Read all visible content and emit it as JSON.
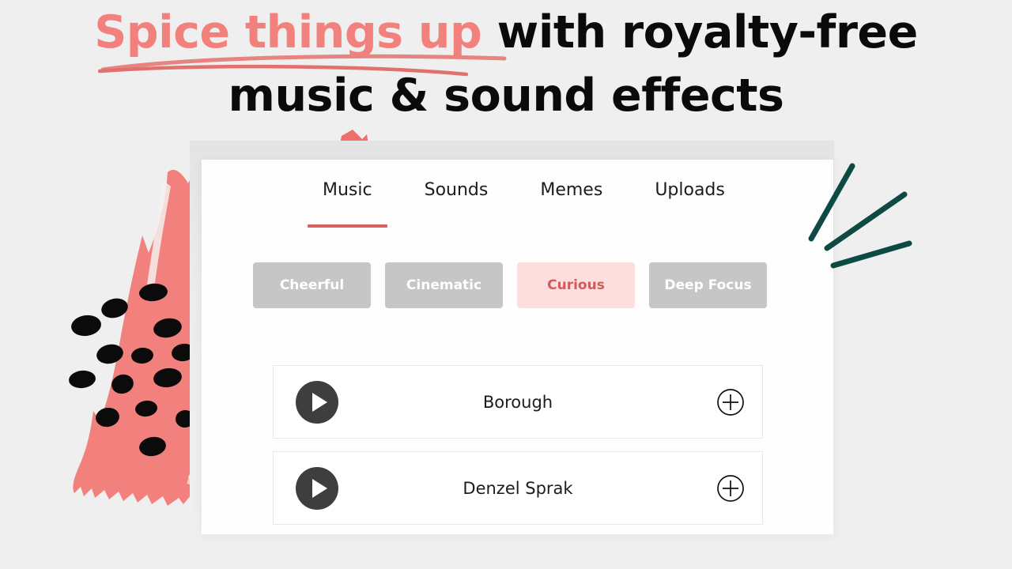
{
  "headline": {
    "accent_text": "Spice things up",
    "rest_line1": " with royalty-free",
    "line2": "music & sound effects",
    "accent_color": "#f2817d",
    "text_color": "#0a0a0a"
  },
  "card": {
    "tabs": [
      {
        "label": "Music",
        "active": true
      },
      {
        "label": "Sounds",
        "active": false
      },
      {
        "label": "Memes",
        "active": false
      },
      {
        "label": "Uploads",
        "active": false
      }
    ],
    "active_tab_underline_color": "#d8615e",
    "chips": [
      {
        "label": "Cheerful",
        "selected": false
      },
      {
        "label": "Cinematic",
        "selected": false
      },
      {
        "label": "Curious",
        "selected": true
      },
      {
        "label": "Deep Focus",
        "selected": false
      }
    ],
    "chip_default_bg": "#c6c6c6",
    "chip_default_text": "#ffffff",
    "chip_selected_bg": "#fbdedd",
    "chip_selected_text": "#d15b5b",
    "tracks": [
      {
        "title": "Borough",
        "play_icon": "play-icon",
        "add_icon": "plus-circle-icon"
      },
      {
        "title": "Denzel Sprak",
        "play_icon": "play-icon",
        "add_icon": "plus-circle-icon"
      }
    ]
  },
  "decorations": {
    "brush_color": "#f2807c",
    "seed_color": "#0b0b0b",
    "teal_color": "#0d4a43",
    "background_color": "#efefef"
  }
}
